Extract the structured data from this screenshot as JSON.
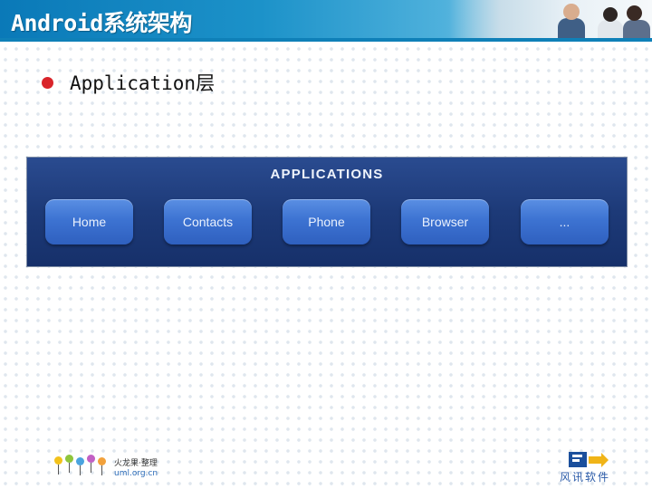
{
  "slide": {
    "title": "Android系统架构",
    "bullet": "Application层"
  },
  "diagram": {
    "layer_title": "APPLICATIONS",
    "apps": [
      "Home",
      "Contacts",
      "Phone",
      "Browser",
      "..."
    ]
  },
  "footer": {
    "left_logo_cn": "火龙果·整理",
    "left_logo_url": "uml.org.cn",
    "right_logo": "风讯软件"
  },
  "colors": {
    "header": "#1c92c9",
    "bullet": "#d9242a",
    "panel": "#1d3a78",
    "button": "#3d73d2"
  }
}
